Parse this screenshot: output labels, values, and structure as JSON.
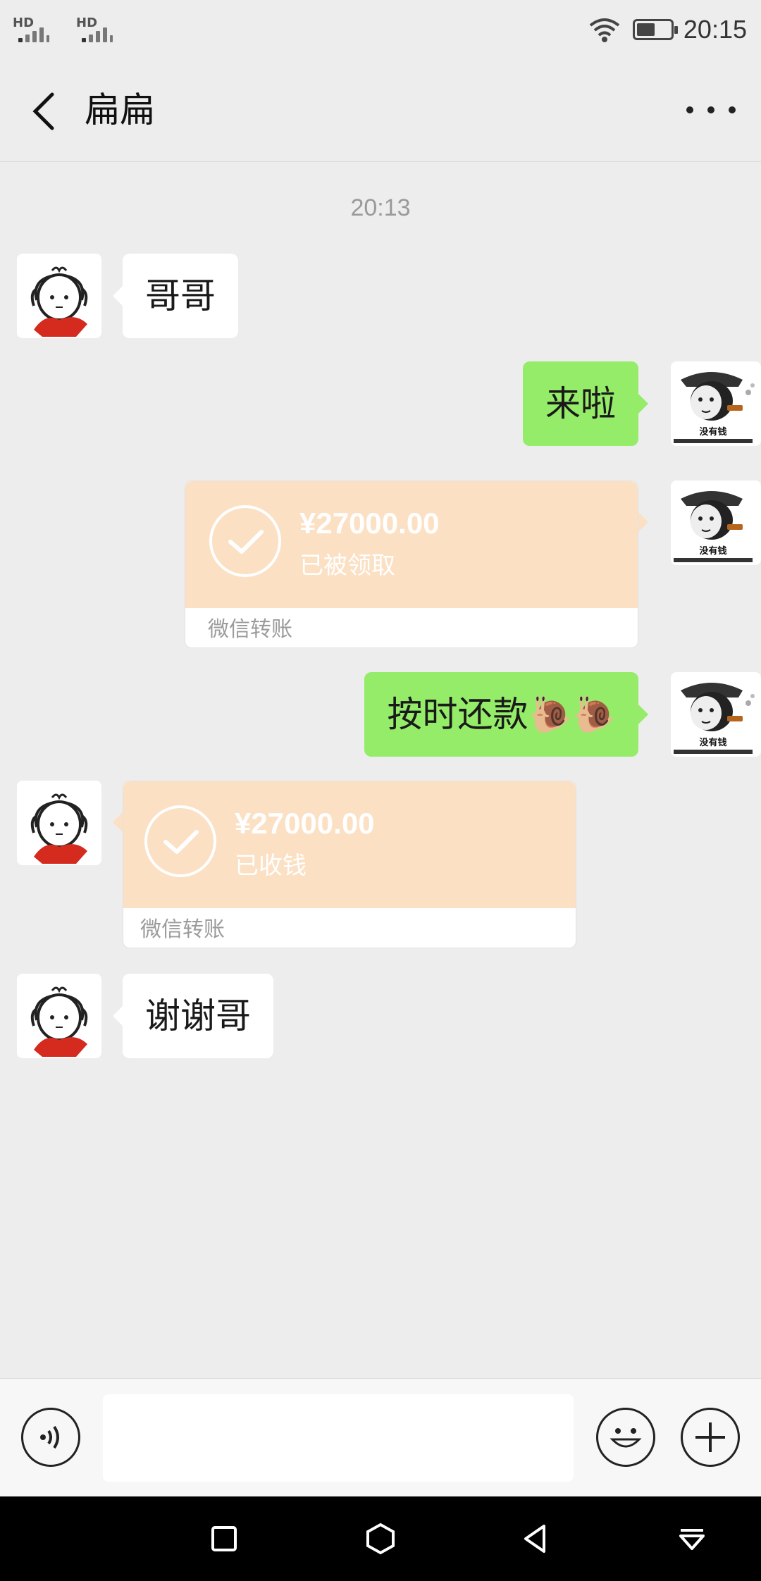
{
  "status_bar": {
    "signal_1": "HD",
    "signal_2": "HD",
    "time": "20:15",
    "battery_level": 0.55
  },
  "header": {
    "title": "扁扁"
  },
  "chat": {
    "timestamp": "20:13",
    "messages": [
      {
        "side": "in",
        "text": "哥哥"
      },
      {
        "side": "out",
        "text": "来啦"
      },
      {
        "side": "out",
        "type": "transfer",
        "amount": "¥27000.00",
        "status": "已被领取",
        "label": "微信转账"
      },
      {
        "side": "out",
        "text": "按时还款🐌🐌"
      },
      {
        "side": "in",
        "type": "transfer",
        "amount": "¥27000.00",
        "status": "已收钱",
        "label": "微信转账"
      },
      {
        "side": "in",
        "text": "谢谢哥"
      }
    ],
    "self_avatar_caption": "没有钱"
  },
  "input_bar": {
    "value": "",
    "placeholder": ""
  },
  "colors": {
    "background": "#ededed",
    "incoming_bubble": "#ffffff",
    "outgoing_bubble": "#95ec69",
    "transfer_card": "#fbe0c4"
  },
  "icons": {
    "back": "chevron-left-icon",
    "more": "more-dots-icon",
    "voice": "voice-icon",
    "emoji": "emoji-icon",
    "plus": "plus-icon",
    "check": "check-icon"
  }
}
